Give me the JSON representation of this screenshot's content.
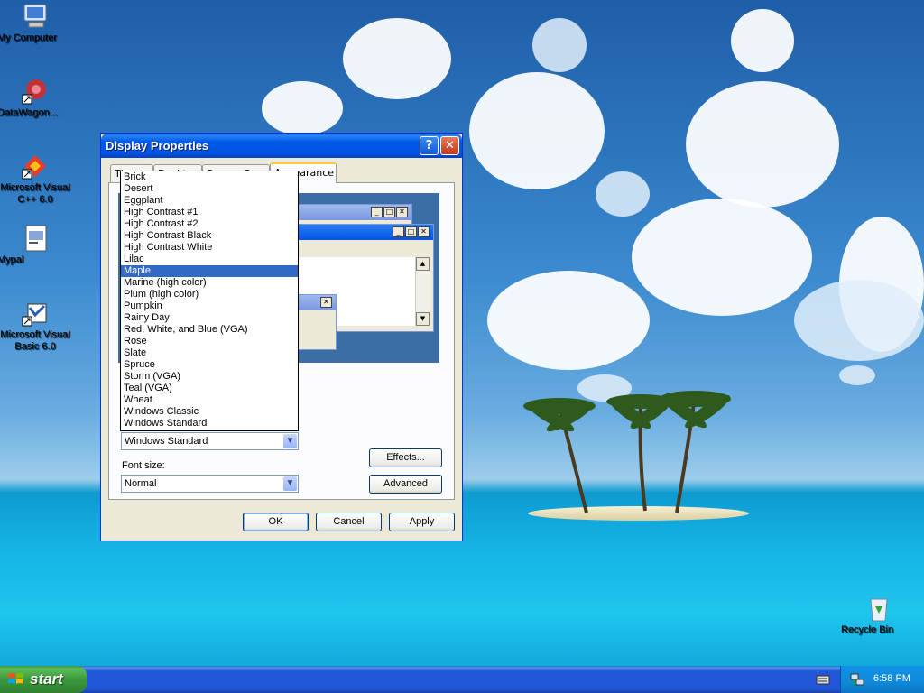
{
  "desktop": {
    "icons": [
      {
        "label": "My Computer",
        "icon": "computer-icon"
      },
      {
        "label": "DataWagon...",
        "icon": "datawagon-icon"
      },
      {
        "label": "Microsoft Visual C++ 6.0",
        "icon": "visual-cpp-icon"
      },
      {
        "label": "Mypal",
        "icon": "mypal-icon"
      },
      {
        "label": "Microsoft Visual Basic 6.0",
        "icon": "visual-basic-icon"
      },
      {
        "label": "Recycle Bin",
        "icon": "recycle-bin-icon"
      }
    ]
  },
  "window": {
    "title": "Display Properties",
    "help_button": "?",
    "close_button": "✕",
    "tabs": [
      {
        "label": "Themes"
      },
      {
        "label": "Desktop"
      },
      {
        "label": "Screen Saver"
      },
      {
        "label": "Appearance",
        "active": true
      }
    ],
    "scheme_options": [
      "Brick",
      "Desert",
      "Eggplant",
      "High Contrast #1",
      "High Contrast #2",
      "High Contrast Black",
      "High Contrast White",
      "Lilac",
      "Maple",
      "Marine (high color)",
      "Plum (high color)",
      "Pumpkin",
      "Rainy Day",
      "Red, White, and Blue (VGA)",
      "Rose",
      "Slate",
      "Spruce",
      "Storm (VGA)",
      "Teal (VGA)",
      "Wheat",
      "Windows Classic",
      "Windows Standard"
    ],
    "highlighted_option": "Maple",
    "scheme_combo_value": "Windows Standard",
    "font_size_label": "Font size:",
    "font_size_value": "Normal",
    "effects_button": "Effects...",
    "advanced_button": "Advanced",
    "ok_button": "OK",
    "cancel_button": "Cancel",
    "apply_button": "Apply"
  },
  "taskbar": {
    "start_label": "start",
    "clock": "6:58 PM"
  },
  "colors": {
    "titlebar": "#0054e3",
    "selection": "#316ac5",
    "taskbar": "#2157d7",
    "start_button": "#3a9a3a",
    "tab_highlight": "#ffc83c"
  }
}
